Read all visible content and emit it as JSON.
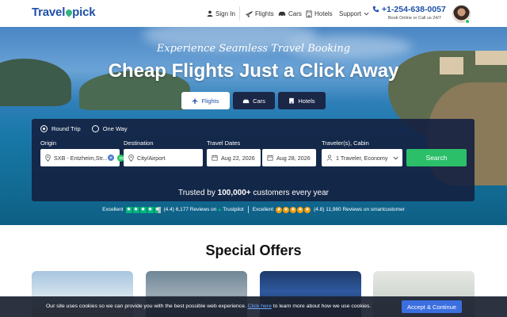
{
  "header": {
    "logo_before": "Travel",
    "logo_after": "pick",
    "nav": {
      "sign_in": "Sign In",
      "flights": "Flights",
      "cars": "Cars",
      "hotels": "Hotels",
      "support": "Support"
    },
    "phone": "+1-254-638-0057",
    "phone_sub": "Book Online or Call us 24/7"
  },
  "hero": {
    "script_title": "Experience Seamless Travel Booking",
    "title": "Cheap Flights Just a Click Away",
    "tabs": [
      {
        "label": "Flights",
        "active": true
      },
      {
        "label": "Cars",
        "active": false
      },
      {
        "label": "Hotels",
        "active": false
      }
    ]
  },
  "search": {
    "trip_types": [
      {
        "label": "Round Trip",
        "selected": true
      },
      {
        "label": "One Way",
        "selected": false
      }
    ],
    "origin_label": "Origin",
    "origin_value": "SXB - Entzheim,Str...",
    "destination_label": "Destination",
    "destination_placeholder": "City/Airport",
    "dates_label": "Travel Dates",
    "depart_date": "Aug 22, 2026",
    "return_date": "Aug 28, 2026",
    "travelers_label": "Traveler(s), Cabin",
    "travelers_value": "1 Traveler, Economy",
    "search_button": "Search"
  },
  "trust": {
    "prefix": "Trusted by ",
    "count": "100,000+",
    "suffix": " customers every year",
    "trustpilot": {
      "label": "Excellent",
      "rating": "(4.4)",
      "reviews": "6,177 Reviews on",
      "brand": "Trustpilot"
    },
    "smartcustomer": {
      "label": "Excellent",
      "rating": "(4.8)",
      "reviews": "11,980 Reviews on",
      "brand": "smartcustomer"
    }
  },
  "offers": {
    "title": "Special Offers"
  },
  "cookie": {
    "text_before": "Our site uses cookies so we can provide you with the best possible web experience.",
    "link": "Click here",
    "text_after": "to learn more about how we use cookies.",
    "button": "Accept & Continue"
  },
  "colors": {
    "brand_blue": "#1e4fa8",
    "search_green": "#2bbf6a",
    "panel_navy": "#142040",
    "trustpilot_green": "#00b67a",
    "accept_blue": "#3b6fe0"
  }
}
